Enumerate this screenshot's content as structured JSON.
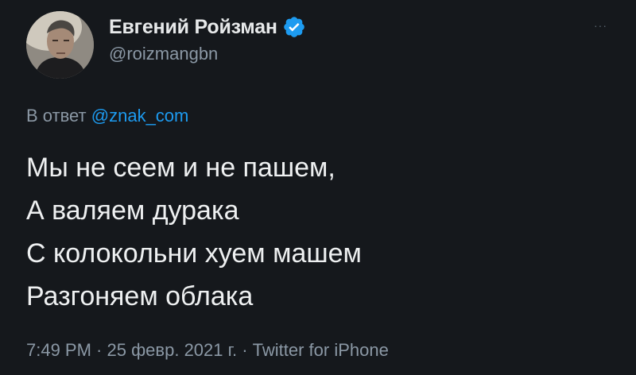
{
  "author": {
    "display_name": "Евгений Ройзман",
    "handle": "@roizmangbn",
    "verified": true
  },
  "menu": {
    "more_label": "···"
  },
  "reply": {
    "prefix": "В ответ",
    "mention": "@znak_com"
  },
  "tweet": {
    "lines": [
      "Мы не сеем и не пашем,",
      "А валяем дурака",
      "С колокольни хуем машем",
      "Разгоняем облака"
    ]
  },
  "meta": {
    "time": "7:49 PM",
    "separator_1": " · ",
    "date": "25 февр. 2021 г.",
    "separator_2": " · ",
    "source": "Twitter for iPhone"
  },
  "colors": {
    "background": "#15181c",
    "text": "#e7e9ea",
    "secondary": "#8b98a5",
    "accent": "#1d9bf0"
  },
  "icons": {
    "verified": "verified-badge-icon",
    "more": "more-dots-icon",
    "avatar": "profile-photo"
  }
}
